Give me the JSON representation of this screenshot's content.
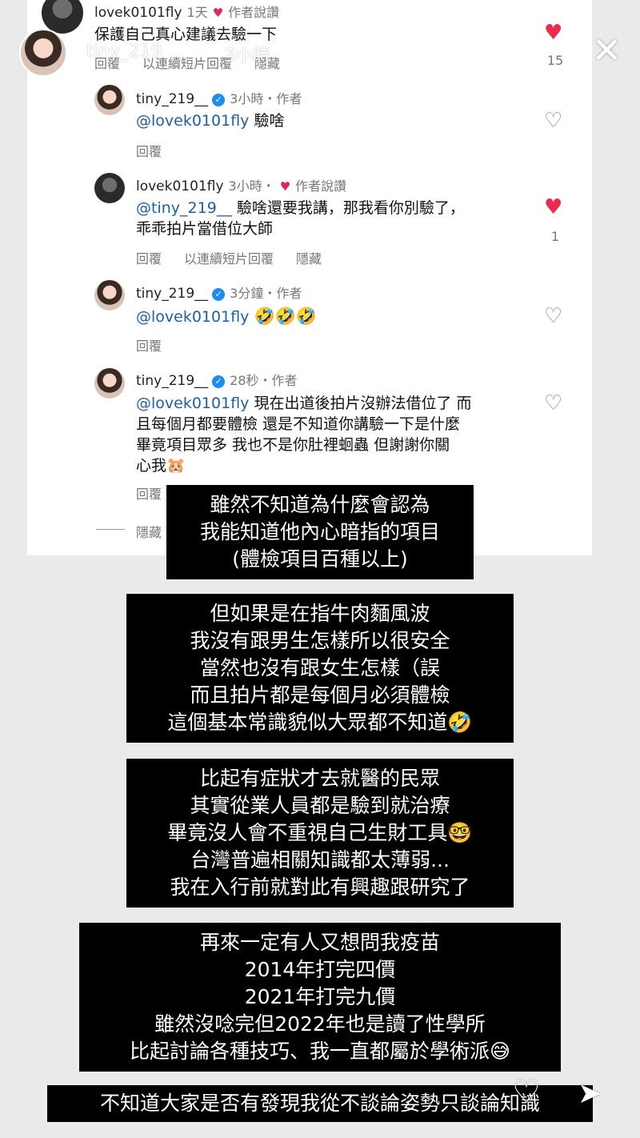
{
  "story": {
    "username": "tiny_219",
    "time": "3小時"
  },
  "comments": [
    {
      "user": "lovek0101fly",
      "meta": "1天",
      "author_liked": "作者說讚",
      "text": "保護自己真心建議去驗一下",
      "actions": [
        "回覆",
        "以連續短片回覆",
        "隱藏"
      ],
      "liked": true,
      "likes": "15"
    },
    {
      "user": "tiny_219__",
      "meta": "3小時・作者",
      "mention": "@lovek0101fly",
      "text": "驗啥",
      "actions": [
        "回覆"
      ],
      "liked": false,
      "likes": ""
    },
    {
      "user": "lovek0101fly",
      "meta": "3小時・",
      "author_liked": "作者說讚",
      "mention": "@tiny_219__",
      "text": "驗啥還要我講，那我看你別驗了，",
      "text2": "乖乖拍片當借位大師",
      "actions": [
        "回覆",
        "以連續短片回覆",
        "隱藏"
      ],
      "liked": true,
      "likes": "1"
    },
    {
      "user": "tiny_219__",
      "meta": "3分鐘・作者",
      "mention": "@lovek0101fly",
      "text": "🤣🤣🤣",
      "actions": [
        "回覆"
      ],
      "liked": false,
      "likes": ""
    },
    {
      "user": "tiny_219__",
      "meta": "28秒・作者",
      "mention": "@lovek0101fly",
      "text": "現在出道後拍片沒辦法借位了 而",
      "text2": "且每個月都要體檢 還是不知道你講驗一下是什麼",
      "text3": "畢竟項目眾多 我也不是你肚裡蛔蟲 但謝謝你關",
      "text4": "心我🐹",
      "actions": [
        "回覆",
        "隱藏"
      ],
      "liked": false,
      "likes": ""
    }
  ],
  "overlays": [
    [
      "雖然不知道為什麼會認為",
      "我能知道他內心暗指的項目",
      "(體檢項目百種以上)"
    ],
    [
      "但如果是在指牛肉麵風波",
      "我沒有跟男生怎樣所以很安全",
      "當然也沒有跟女生怎樣（誤",
      "而且拍片都是每個月必須體檢",
      "這個基本常識貌似大眾都不知道🤣"
    ],
    [
      "比起有症狀才去就醫的民眾",
      "其實從業人員都是驗到就治療",
      "畢竟沒人會不重視自己生財工具🤓",
      "台灣普遍相關知識都太薄弱...",
      "我在入行前就對此有興趣跟研究了"
    ],
    [
      "再來一定有人又想問我疫苗",
      "2014年打完四價",
      "2021年打完九價",
      "雖然沒唸完但2022年也是讀了性學所",
      "比起討論各種技巧、我一直都屬於學術派😅"
    ],
    [
      "不知道大家是否有發現我從不談論姿勢只談論知識"
    ]
  ],
  "icons": {
    "close": "close-icon",
    "heart": "heart-icon",
    "send": "send-icon"
  },
  "colors": {
    "like_red": "#ed2c4d",
    "mention_blue": "#1f5fa8",
    "verified_blue": "#1d8cf0"
  }
}
